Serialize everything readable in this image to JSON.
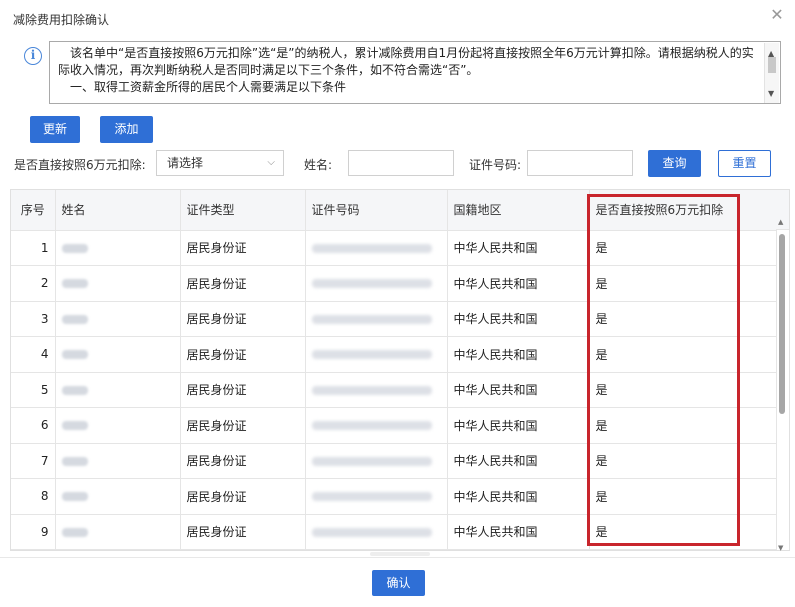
{
  "dialog": {
    "title": "减除费用扣除确认",
    "close_icon": "close-icon"
  },
  "notice": {
    "icon": "info-icon",
    "lines": [
      "　该名单中“是否直接按照6万元扣除”选“是”的纳税人，累计减除费用自1月份起将直接按照全年6万元计算扣除。请根据纳税人的实际收入情况，再次判断纳税人是否同时满足以下三个条件，如不符合需选“否”。",
      "　一、取得工资薪金所得的居民个人需要满足以下条件"
    ]
  },
  "toolbar": {
    "refresh_label": "更新",
    "add_label": "添加"
  },
  "filters": {
    "deduct_label": "是否直接按照6万元扣除:",
    "deduct_select": "请选择",
    "name_label": "姓名:",
    "id_label": "证件号码:",
    "query_label": "查询",
    "reset_label": "重置"
  },
  "table": {
    "columns": [
      "序号",
      "姓名",
      "证件类型",
      "证件号码",
      "国籍地区",
      "是否直接按照6万元扣除"
    ],
    "rows": [
      {
        "index": "1",
        "id_type": "居民身份证",
        "nationality": "中华人民共和国",
        "deduct": "是"
      },
      {
        "index": "2",
        "id_type": "居民身份证",
        "nationality": "中华人民共和国",
        "deduct": "是"
      },
      {
        "index": "3",
        "id_type": "居民身份证",
        "nationality": "中华人民共和国",
        "deduct": "是"
      },
      {
        "index": "4",
        "id_type": "居民身份证",
        "nationality": "中华人民共和国",
        "deduct": "是"
      },
      {
        "index": "5",
        "id_type": "居民身份证",
        "nationality": "中华人民共和国",
        "deduct": "是"
      },
      {
        "index": "6",
        "id_type": "居民身份证",
        "nationality": "中华人民共和国",
        "deduct": "是"
      },
      {
        "index": "7",
        "id_type": "居民身份证",
        "nationality": "中华人民共和国",
        "deduct": "是"
      },
      {
        "index": "8",
        "id_type": "居民身份证",
        "nationality": "中华人民共和国",
        "deduct": "是"
      },
      {
        "index": "9",
        "id_type": "居民身份证",
        "nationality": "中华人民共和国",
        "deduct": "是"
      }
    ]
  },
  "footer": {
    "confirm_label": "确认"
  },
  "colors": {
    "primary": "#2f6fd6",
    "highlight": "#c8252c"
  }
}
